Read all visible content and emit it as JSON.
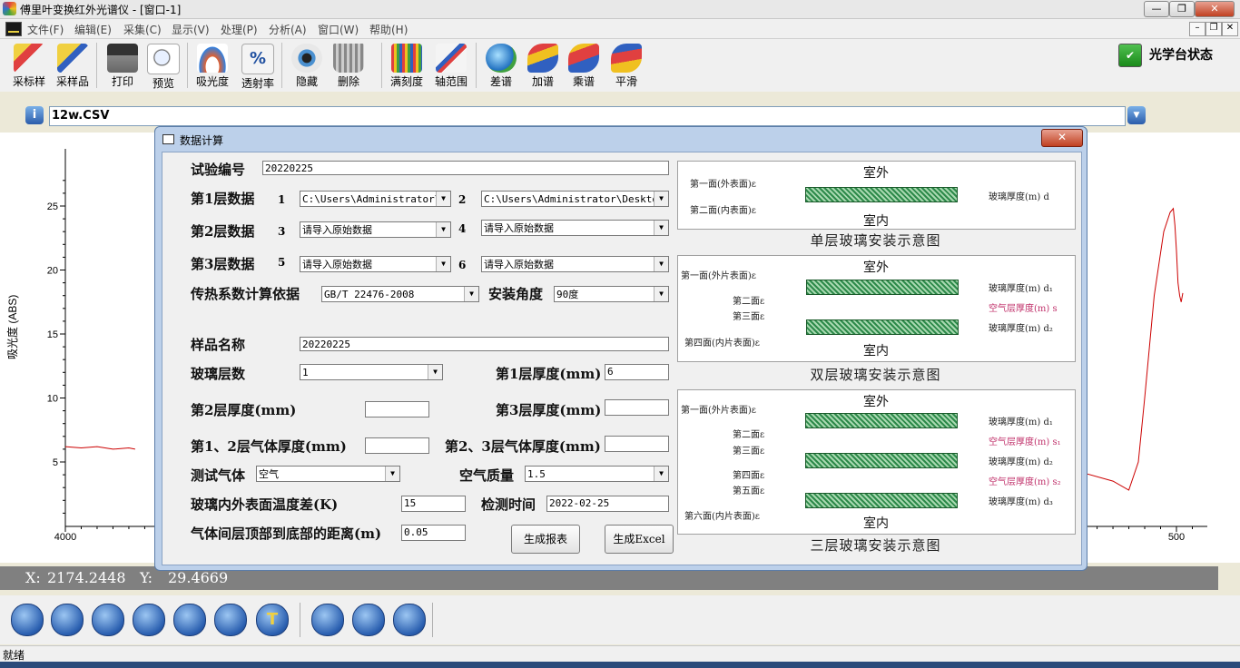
{
  "window": {
    "title": "傅里叶变换红外光谱仪 - [窗口-1]"
  },
  "menu": [
    "文件(F)",
    "编辑(E)",
    "采集(C)",
    "显示(V)",
    "处理(P)",
    "分析(A)",
    "窗口(W)",
    "帮助(H)"
  ],
  "toolbar": {
    "buttons": [
      "采标样",
      "采样品",
      "打印",
      "预览",
      "吸光度",
      "透射率",
      "隐藏",
      "删除",
      "满刻度",
      "轴范围",
      "差谱",
      "加谱",
      "乘谱",
      "平滑"
    ],
    "status_label": "光学台状态"
  },
  "file": {
    "name": "12w.CSV"
  },
  "chart_data": {
    "type": "line",
    "ylabel": "吸光度 (ABS)",
    "yticks": [
      "25",
      "20",
      "15",
      "10",
      "5"
    ],
    "xticks": [
      "4000",
      "500"
    ],
    "series": [
      {
        "x": [
          4000,
          3950,
          3900,
          3850,
          3800,
          3780
        ],
        "y": [
          6.2,
          6.1,
          6.2,
          6.0,
          6.1,
          6.0
        ]
      },
      {
        "x": [
          1000,
          900,
          800,
          700,
          650,
          620,
          600,
          570,
          540,
          520,
          510,
          505,
          500,
          495,
          490,
          485,
          480
        ],
        "y": [
          6.7,
          5.5,
          4.2,
          3.5,
          2.8,
          5.0,
          10.0,
          18.0,
          23.0,
          24.5,
          24.8,
          23.5,
          21.5,
          19.0,
          18.0,
          17.5,
          18.2
        ]
      }
    ]
  },
  "coords": {
    "x_label": "X:",
    "x_value": "2174.2448",
    "y_label": "Y:",
    "y_value": "29.4669"
  },
  "status": "就绪",
  "dialog": {
    "title": "数据计算",
    "test_no_label": "试验编号",
    "test_no": "20220225",
    "layer1_label": "第1层数据",
    "layer2_label": "第2层数据",
    "layer3_label": "第3层数据",
    "n1": "1",
    "n2": "2",
    "n3": "3",
    "n4": "4",
    "n5": "5",
    "n6": "6",
    "file1": "C:\\Users\\Administrator\\Desktop\\",
    "file2": "C:\\Users\\Administrator\\Desktop\\",
    "file_placeholder": "请导入原始数据",
    "basis_label": "传热系数计算依据",
    "basis": "GB/T 22476-2008",
    "angle_label": "安装角度",
    "angle": "90度",
    "sample_name_label": "样品名称",
    "sample_name": "20220225",
    "glass_layers_label": "玻璃层数",
    "glass_layers": "1",
    "thick1_label": "第1层厚度(mm)",
    "thick1": "6",
    "thick2_label": "第2层厚度(mm)",
    "thick2": "",
    "thick3_label": "第3层厚度(mm)",
    "thick3": "",
    "gas12_label": "第1、2层气体厚度(mm)",
    "gas12": "",
    "gas23_label": "第2、3层气体厚度(mm)",
    "gas23": "",
    "test_gas_label": "测试气体",
    "test_gas": "空气",
    "air_quality_label": "空气质量",
    "air_quality": "1.5",
    "temp_diff_label": "玻璃内外表面温度差(K)",
    "temp_diff": "15",
    "test_time_label": "检测时间",
    "test_time": "2022-02-25",
    "distance_label": "气体间层顶部到底部的距离(m)",
    "distance": "0.05",
    "report_button": "生成报表",
    "excel_button": "生成Excel"
  },
  "diagrams": {
    "outdoor": "室外",
    "indoor": "室内",
    "single": {
      "caption": "单层玻璃安装示意图",
      "face1": "第一面(外表面)ε",
      "face2": "第二面(内表面)ε",
      "thick": "玻璃厚度(m) d"
    },
    "double": {
      "caption": "双层玻璃安装示意图",
      "face1": "第一面(外片表面)ε",
      "face2": "第二面ε",
      "face3": "第三面ε",
      "face4": "第四面(内片表面)ε",
      "d1": "玻璃厚度(m) d₁",
      "s": "空气层厚度(m) s",
      "d2": "玻璃厚度(m) d₂"
    },
    "triple": {
      "caption": "三层玻璃安装示意图",
      "face1": "第一面(外片表面)ε",
      "face2": "第二面ε",
      "face3": "第三面ε",
      "face4": "第四面ε",
      "face5": "第五面ε",
      "face6": "第六面(内片表面)ε",
      "d1": "玻璃厚度(m) d₁",
      "s1": "空气层厚度(m) s₁",
      "d2": "玻璃厚度(m) d₂",
      "s2": "空气层厚度(m) s₂",
      "d3": "玻璃厚度(m) d₃"
    }
  },
  "colors": {
    "curve": "#cc0000",
    "dialog_border": "#bcd0ea",
    "glass": "#2d8a4a",
    "air": "#c0306a"
  }
}
